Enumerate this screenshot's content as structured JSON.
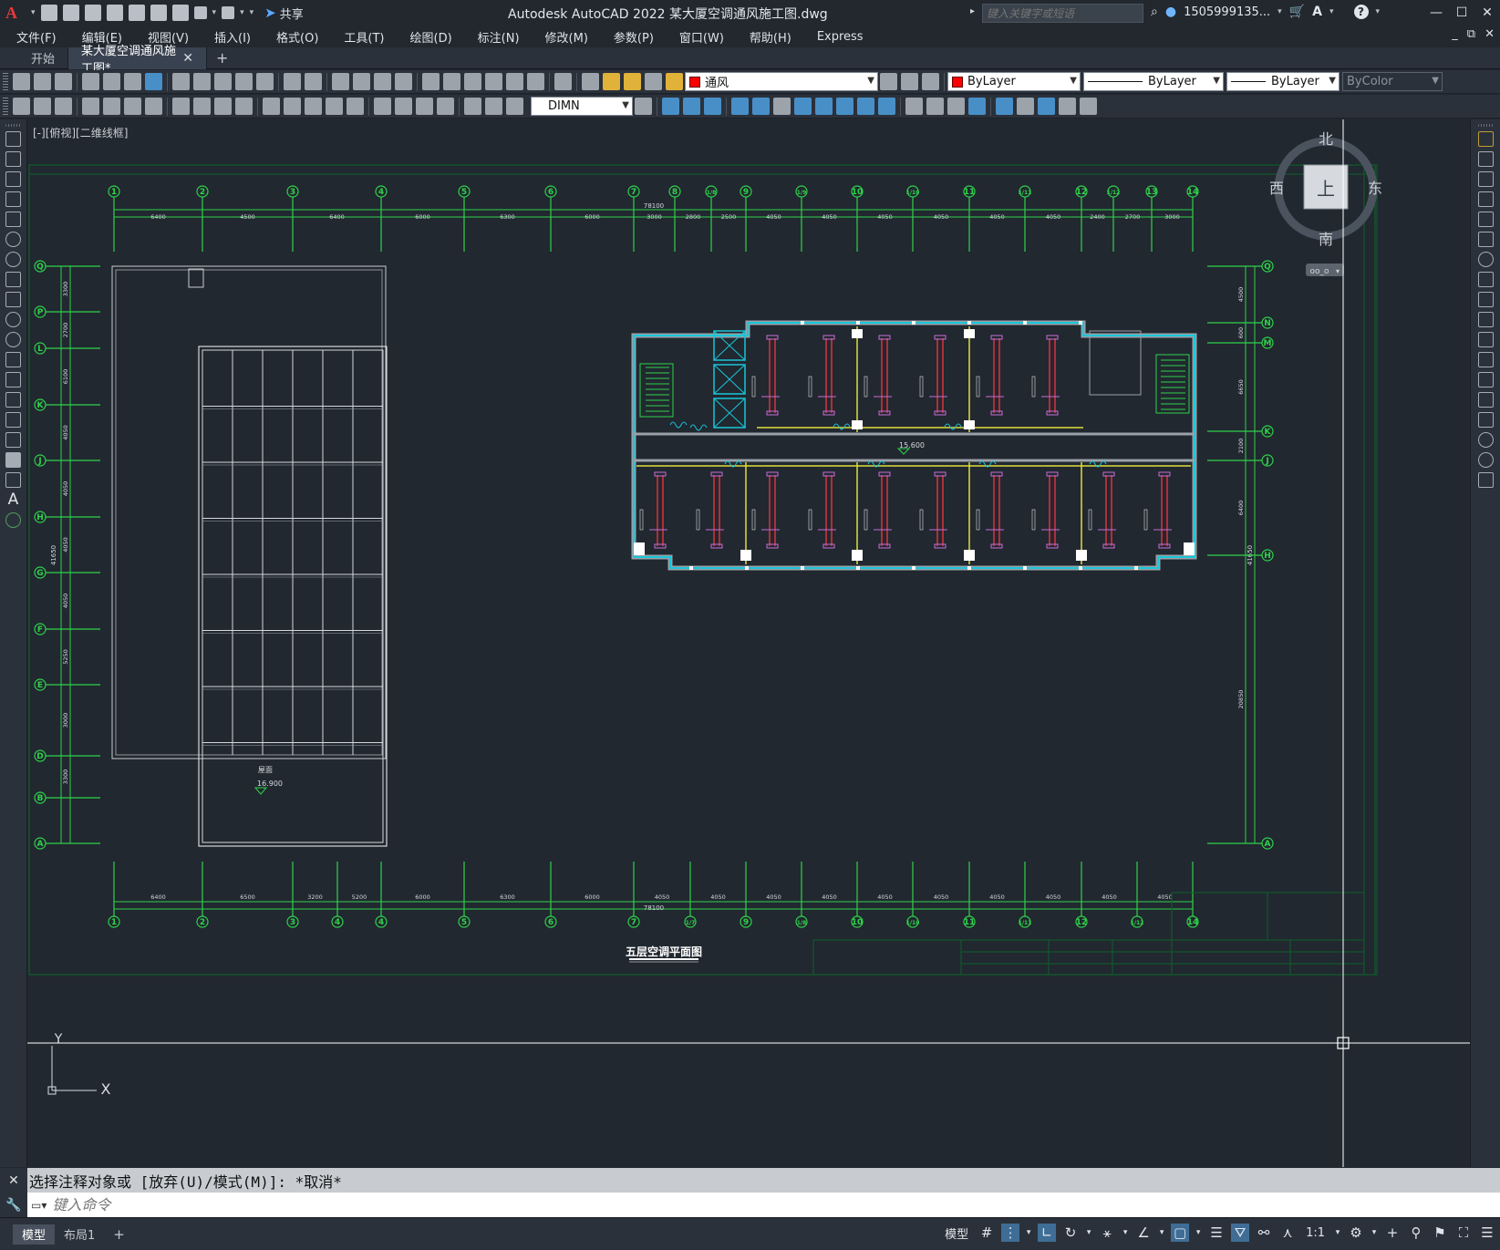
{
  "app": {
    "title": "Autodesk AutoCAD 2022    某大厦空调通风施工图.dwg",
    "share_label": "共享",
    "search_placeholder": "键入关键字或短语",
    "user": "1505999135...",
    "window_controls": [
      "—",
      "☐",
      "✕"
    ]
  },
  "menu": {
    "items": [
      "文件(F)",
      "编辑(E)",
      "视图(V)",
      "插入(I)",
      "格式(O)",
      "工具(T)",
      "绘图(D)",
      "标注(N)",
      "修改(M)",
      "参数(P)",
      "窗口(W)",
      "帮助(H)",
      "Express"
    ],
    "doc_controls": [
      "_",
      "⧉",
      "✕"
    ]
  },
  "tabs": {
    "start": "开始",
    "active": "某大厦空调通风施工图*",
    "close": "✕",
    "add": "+"
  },
  "toolbar": {
    "layer": "通风",
    "color": "ByLayer",
    "linetype": "ByLayer",
    "lineweight": "ByLayer",
    "plotstyle": "ByColor",
    "dimstyle": "DIMN"
  },
  "viewport": {
    "label": "[-][俯视][二维线框]",
    "viewcube": {
      "north": "北",
      "south": "南",
      "east": "东",
      "west": "西",
      "top": "上",
      "wcs": "oo_o"
    },
    "ucs": {
      "x": "X",
      "y": "Y"
    }
  },
  "drawing": {
    "title": "五层空调平面图",
    "top_axes": [
      "1",
      "2",
      "3",
      "4",
      "5",
      "6",
      "7",
      "8",
      "1/8",
      "9",
      "1/9",
      "10",
      "1/10",
      "11",
      "1/11",
      "12",
      "1/12",
      "13",
      "14"
    ],
    "top_dims": [
      "6400",
      "4500",
      "6400",
      "6000",
      "6300",
      "6000",
      "3000",
      "2800",
      "2500",
      "4050",
      "4050",
      "4050",
      "4050",
      "4050",
      "4050",
      "2400",
      "2700",
      "3000"
    ],
    "top_total": "78100",
    "bottom_axes": [
      "1",
      "2",
      "3",
      "4",
      "4",
      "5",
      "6",
      "7",
      "1/7",
      "9",
      "1/8",
      "10",
      "1/10",
      "11",
      "1/11",
      "12",
      "1/12",
      "14"
    ],
    "bottom_dims": [
      "6400",
      "6500",
      "3200",
      "5200",
      "6000",
      "6300",
      "6000",
      "4050",
      "4050",
      "4050",
      "4050",
      "4050",
      "4050",
      "4050",
      "4050",
      "4050",
      "4050"
    ],
    "bottom_total": "78100",
    "left_axes": [
      "Q",
      "P",
      "L",
      "K",
      "J",
      "H",
      "G",
      "F",
      "E",
      "D",
      "B",
      "A"
    ],
    "left_dims": [
      "3300",
      "2700",
      "6100",
      "4050",
      "4050",
      "4050",
      "4050",
      "5250",
      "3000",
      "3300"
    ],
    "left_total": "41650",
    "right_axes": [
      "Q",
      "N",
      "M",
      "K",
      "J",
      "H",
      "A"
    ],
    "right_dims": [
      "4500",
      "600",
      "6650",
      "2100",
      "6400",
      "20850"
    ],
    "right_total": "41650",
    "level_left_label": "屋面",
    "level_left": "16.900",
    "level_plan": "15.600"
  },
  "command": {
    "history": "选择注释对象或 [放弃(U)/模式(M)]: *取消*",
    "placeholder": "键入命令"
  },
  "status": {
    "tabs": [
      "模型",
      "布局1"
    ],
    "add": "+",
    "model_label": "模型",
    "scale": "1:1"
  }
}
